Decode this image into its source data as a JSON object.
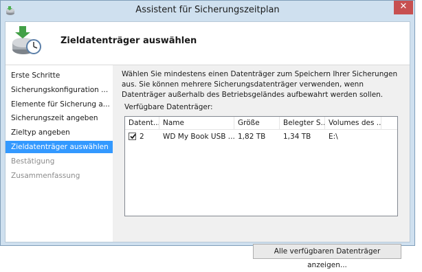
{
  "window": {
    "title": "Assistent für Sicherungszeitplan",
    "close_glyph": "✕"
  },
  "header": {
    "title": "Zieldatenträger auswählen",
    "icon": "backup-schedule-icon"
  },
  "nav": {
    "items": [
      {
        "label": "Erste Schritte",
        "state": "normal"
      },
      {
        "label": "Sicherungskonfiguration ...",
        "state": "normal"
      },
      {
        "label": "Elemente für Sicherung a...",
        "state": "normal"
      },
      {
        "label": "Sicherungszeit angeben",
        "state": "normal"
      },
      {
        "label": "Zieltyp angeben",
        "state": "normal"
      },
      {
        "label": "Zieldatenträger auswählen",
        "state": "active"
      },
      {
        "label": "Bestätigung",
        "state": "disabled"
      },
      {
        "label": "Zusammenfassung",
        "state": "disabled"
      }
    ]
  },
  "content": {
    "description": "Wählen Sie mindestens einen Datenträger zum Speichern Ihrer Sicherungen aus. Sie können mehrere Sicherungsdatenträger verwenden, wenn Datenträger außerhalb des Betriebsgeländes aufbewahrt werden sollen.",
    "available_label": "Verfügbare Datenträger:",
    "columns": [
      "Datent...",
      "Name",
      "Größe",
      "Belegter S...",
      "Volumes des ..."
    ],
    "rows": [
      {
        "checked": true,
        "disk": "2",
        "name": "WD My Book USB ...",
        "size": "1,82 TB",
        "used": "1,34 TB",
        "volumes": "E:\\"
      }
    ],
    "show_all_button": "Alle verfügbaren Datenträger anzeigen..."
  },
  "colors": {
    "selection": "#3399ff",
    "titlebar": "#cfe0ef",
    "close": "#c75050"
  }
}
